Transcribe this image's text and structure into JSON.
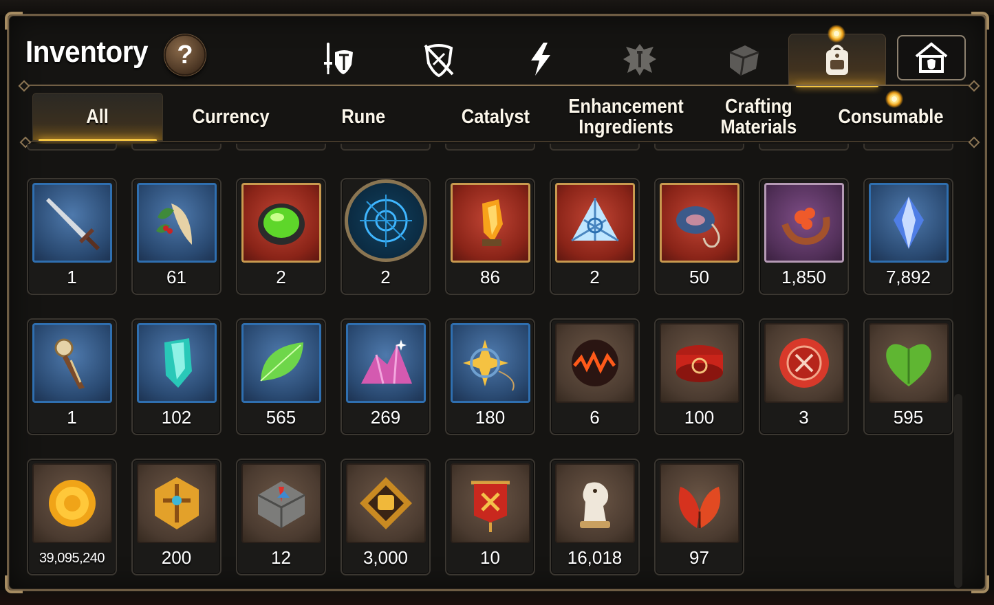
{
  "window": {
    "title": "Inventory",
    "help_label": "?"
  },
  "category_tabs": [
    {
      "id": "equipment",
      "icon": "sword-shield-icon",
      "active": false
    },
    {
      "id": "no-shield",
      "icon": "crossed-shield-icon",
      "active": false
    },
    {
      "id": "lightning",
      "icon": "lightning-icon",
      "active": false
    },
    {
      "id": "emblem",
      "icon": "winged-emblem-icon",
      "active": false
    },
    {
      "id": "cube",
      "icon": "cube-icon",
      "active": false
    },
    {
      "id": "backpack",
      "icon": "backpack-icon",
      "active": true
    },
    {
      "id": "house",
      "icon": "guild-house-icon",
      "active": false
    }
  ],
  "filter_tabs": [
    {
      "label": "All",
      "active": true
    },
    {
      "label": "Currency",
      "active": false
    },
    {
      "label": "Rune",
      "active": false
    },
    {
      "label": "Catalyst",
      "active": false
    },
    {
      "label": "Enhancement\nIngredients",
      "active": false
    },
    {
      "label": "Crafting\nMaterials",
      "active": false
    },
    {
      "label": "Consumable",
      "active": false
    }
  ],
  "items": [
    {
      "name": "sword-item",
      "icon": "sword-icon",
      "frame": "blue",
      "quantity": "1"
    },
    {
      "name": "herb-item",
      "icon": "herb-root-icon",
      "frame": "blue",
      "quantity": "61"
    },
    {
      "name": "green-orb-item",
      "icon": "green-orb-icon",
      "frame": "red",
      "quantity": "2"
    },
    {
      "name": "rune-disc-item",
      "icon": "rune-disc-icon",
      "frame": "round",
      "quantity": "2"
    },
    {
      "name": "fire-crystal-item",
      "icon": "fire-crystal-icon",
      "frame": "red",
      "quantity": "86"
    },
    {
      "name": "triangle-gem-item",
      "icon": "triangle-gem-icon",
      "frame": "red",
      "quantity": "2"
    },
    {
      "name": "eye-ring-item",
      "icon": "eye-ring-icon",
      "frame": "red",
      "quantity": "50"
    },
    {
      "name": "flower-ring-item",
      "icon": "flower-ring-icon",
      "frame": "purple",
      "quantity": "1,850"
    },
    {
      "name": "blue-crystal-item",
      "icon": "blue-crystal-icon",
      "frame": "blue",
      "quantity": "7,892"
    },
    {
      "name": "clock-dagger-item",
      "icon": "clock-dagger-icon",
      "frame": "blue",
      "quantity": "1"
    },
    {
      "name": "teal-crystal-item",
      "icon": "teal-crystal-icon",
      "frame": "blue",
      "quantity": "102"
    },
    {
      "name": "green-leaf-item",
      "icon": "leaf-icon",
      "frame": "blue",
      "quantity": "565"
    },
    {
      "name": "pink-ore-item",
      "icon": "pink-ore-icon",
      "frame": "blue",
      "quantity": "269"
    },
    {
      "name": "star-amulet-item",
      "icon": "star-amulet-icon",
      "frame": "blue",
      "quantity": "180"
    },
    {
      "name": "lava-orb-item",
      "icon": "lava-orb-icon",
      "frame": "brown",
      "quantity": "6"
    },
    {
      "name": "red-band-item",
      "icon": "red-band-icon",
      "frame": "brown",
      "quantity": "100"
    },
    {
      "name": "red-seal-item",
      "icon": "red-seal-icon",
      "frame": "brown",
      "quantity": "3"
    },
    {
      "name": "green-heart-item",
      "icon": "heart-icon",
      "frame": "brown",
      "quantity": "595"
    },
    {
      "name": "gold-coin-item",
      "icon": "gold-coin-icon",
      "frame": "brown",
      "quantity": "39,095,240"
    },
    {
      "name": "gold-emblem-item",
      "icon": "gold-emblem-icon",
      "frame": "brown",
      "quantity": "200"
    },
    {
      "name": "compass-stone-item",
      "icon": "compass-stone-icon",
      "frame": "brown",
      "quantity": "12"
    },
    {
      "name": "fist-badge-item",
      "icon": "fist-badge-icon",
      "frame": "brown",
      "quantity": "3,000"
    },
    {
      "name": "war-banner-item",
      "icon": "banner-icon",
      "frame": "brown",
      "quantity": "10"
    },
    {
      "name": "knight-chess-item",
      "icon": "chess-knight-icon",
      "frame": "brown",
      "quantity": "16,018"
    },
    {
      "name": "red-leaves-item",
      "icon": "red-leaves-icon",
      "frame": "brown",
      "quantity": "97"
    }
  ],
  "colors": {
    "accent_gold": "#f4c542",
    "panel_border": "#6f5d44",
    "panel_bg": "#151412",
    "blue_frame": "#2f6fb0",
    "red_frame": "#8a2418"
  }
}
